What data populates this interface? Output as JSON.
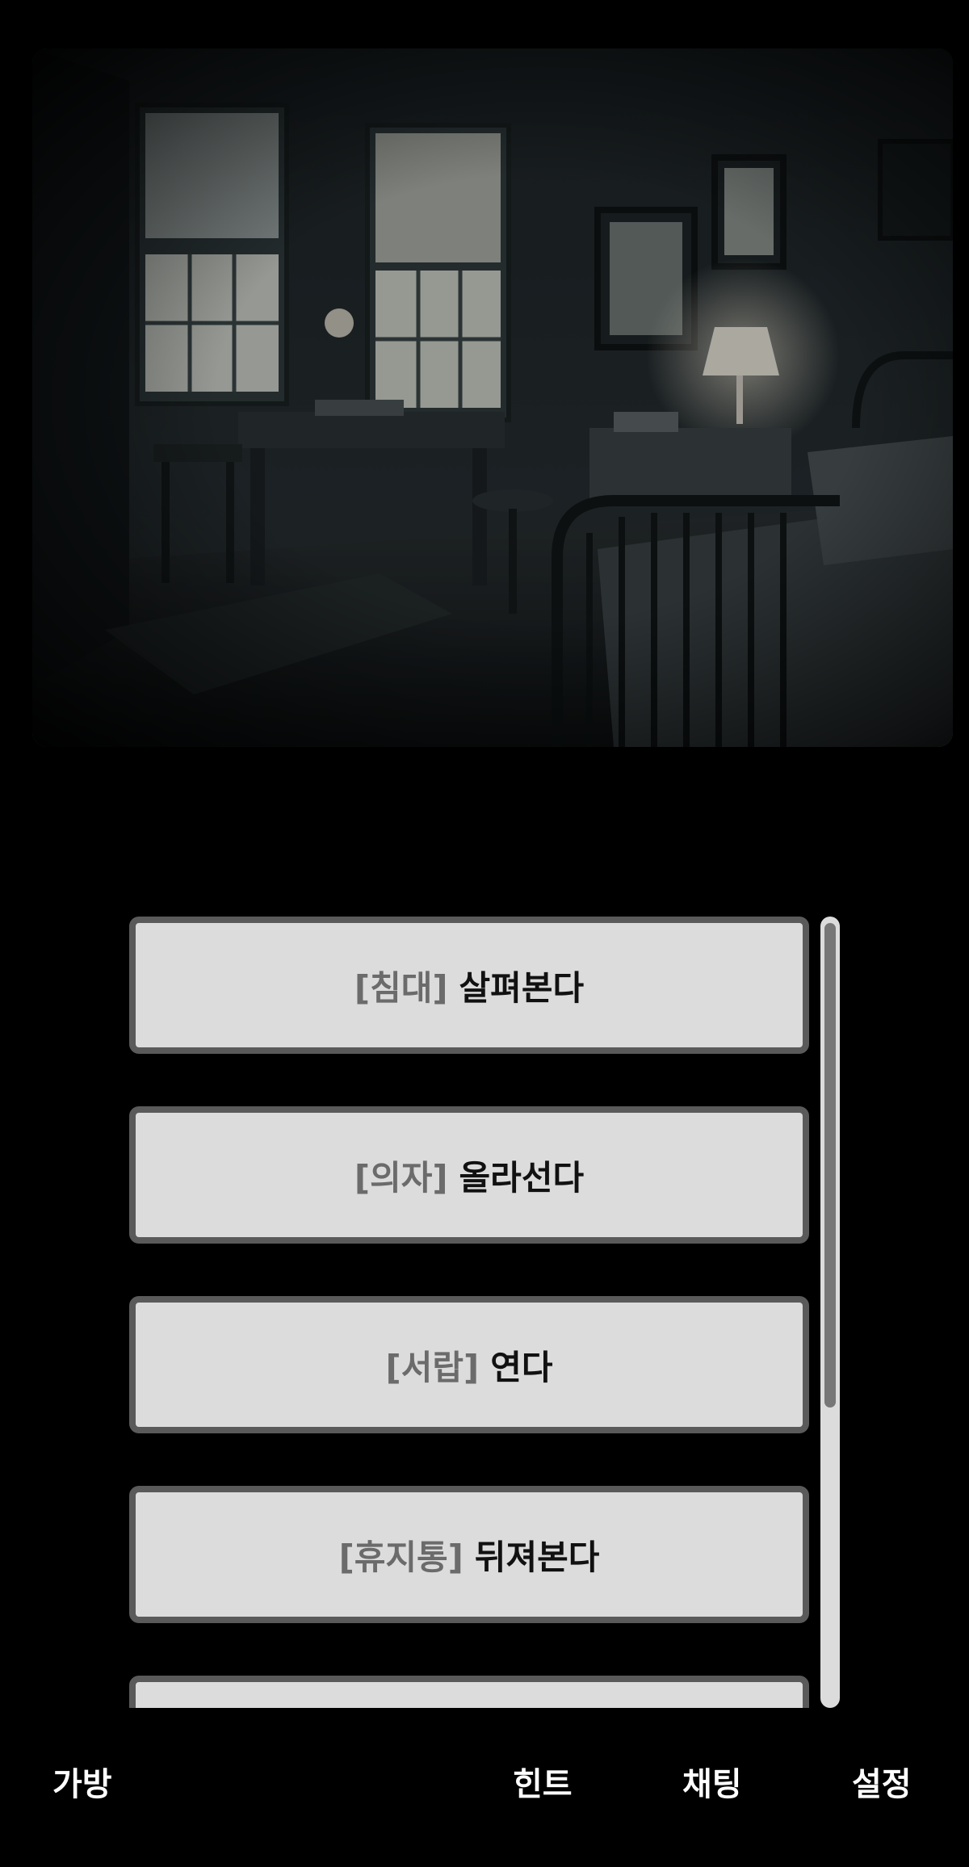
{
  "scene": {
    "description_icon": "dark-bedroom-scene-image"
  },
  "choices": [
    {
      "tag": "[침대]",
      "action": "살펴본다"
    },
    {
      "tag": "[의자]",
      "action": "올라선다"
    },
    {
      "tag": "[서랍]",
      "action": "연다"
    },
    {
      "tag": "[휴지통]",
      "action": "뒤져본다"
    }
  ],
  "nav": {
    "bag": "가방",
    "hint": "힌트",
    "chat": "채팅",
    "settings": "설정"
  },
  "colors": {
    "background": "#000000",
    "button_fill": "#dcdcdc",
    "button_border": "#5a5a5a",
    "tag_text": "#6b6b6b",
    "action_text": "#111111"
  }
}
